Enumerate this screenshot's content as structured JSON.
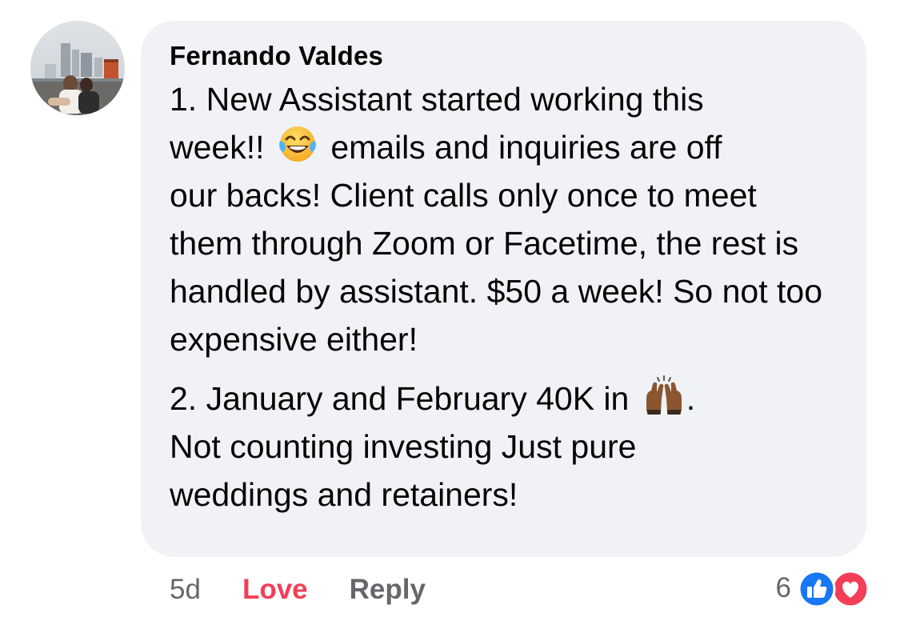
{
  "comment": {
    "author": "Fernando Valdes",
    "paragraph1_line1": "1. New Assistant started working this",
    "paragraph1_line2_pre": "week!!",
    "paragraph1_line2_post": "emails and inquiries are off",
    "paragraph1_rest": "our backs! Client calls only once to meet them through Zoom or Facetime, the rest is handled by assistant. $50 a week! So not too expensive either!",
    "paragraph2_pre": "2. January and February 40K in",
    "paragraph2_post": ".",
    "paragraph2_rest": "Not counting investing Just pure weddings and retainers!",
    "emoji_1": "tears-of-joy-emoji",
    "emoji_2": "raising-hands-emoji"
  },
  "actions": {
    "timestamp": "5d",
    "love_label": "Love",
    "reply_label": "Reply"
  },
  "reactions": {
    "count": "6",
    "icons": [
      "like-icon",
      "love-icon"
    ],
    "like_color": "#1877f2",
    "love_color": "#f33e58"
  }
}
